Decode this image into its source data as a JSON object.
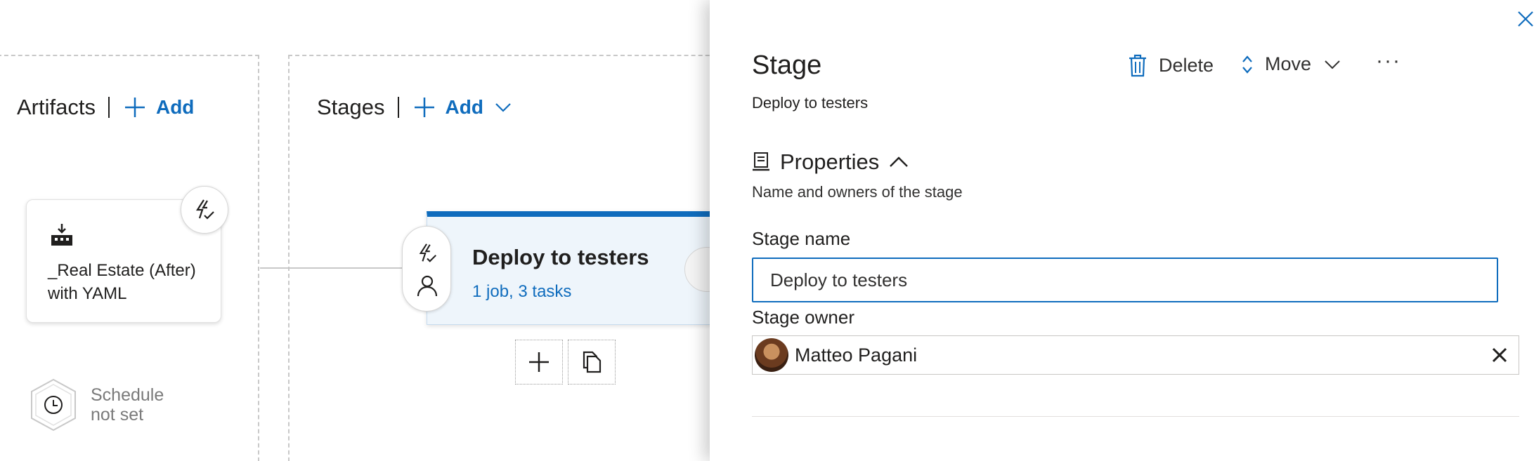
{
  "canvas": {
    "artifacts": {
      "title": "Artifacts",
      "add_label": "Add",
      "card_name": "_Real Estate (After) with YAML",
      "build_icon": "build-pipeline-icon",
      "trigger_icon": "lightning-trigger-icon"
    },
    "schedule": {
      "label_line1": "Schedule",
      "label_line2": "not set",
      "icon": "clock-icon"
    },
    "stages": {
      "title": "Stages",
      "add_label": "Add",
      "stage_card": {
        "name": "Deploy to testers",
        "summary": "1 job, 3 tasks"
      }
    }
  },
  "panel": {
    "title": "Stage",
    "subtitle": "Deploy to testers",
    "toolbar": {
      "delete_label": "Delete",
      "move_label": "Move",
      "more_label": "···"
    },
    "properties": {
      "title": "Properties",
      "description": "Name and owners of the stage"
    },
    "stage_name_label": "Stage name",
    "stage_name_value": "Deploy to testers",
    "stage_owner_label": "Stage owner",
    "stage_owner_value": "Matteo Pagani"
  },
  "colors": {
    "accent": "#0f6cbd",
    "stage_card_bg": "#eef5fb",
    "muted_text": "#7a7a7a"
  }
}
